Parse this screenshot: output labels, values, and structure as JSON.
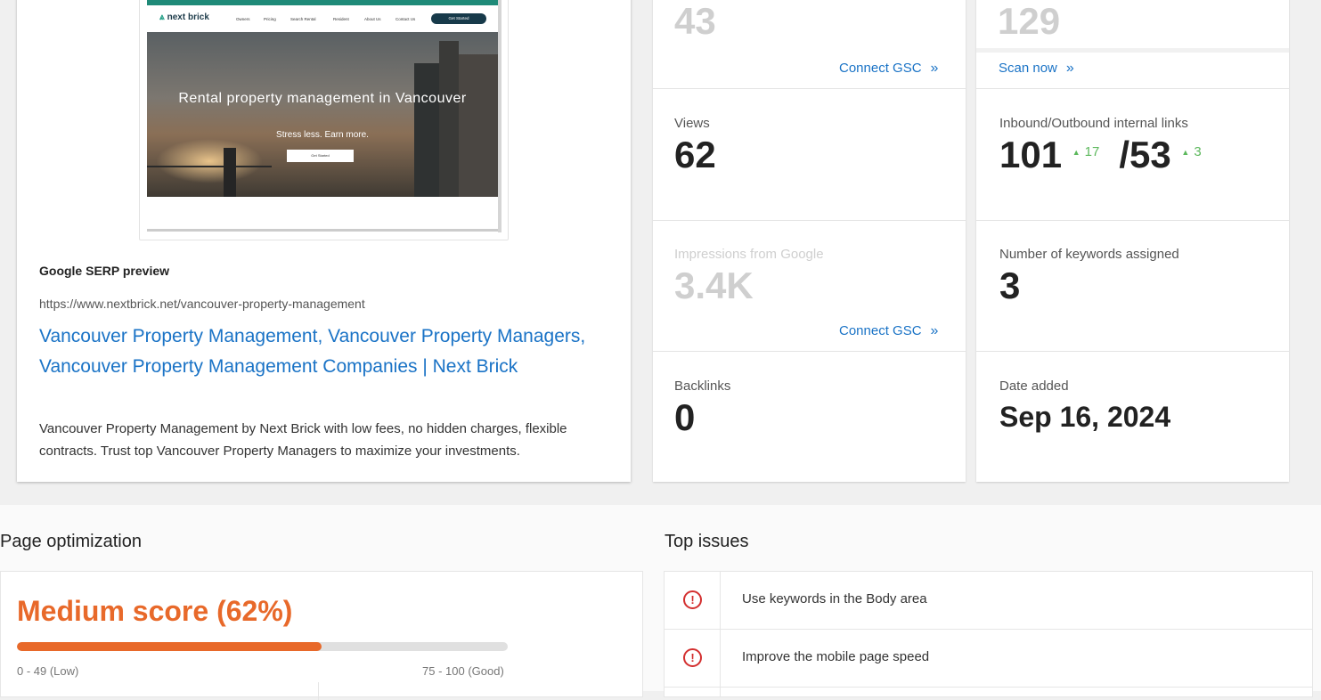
{
  "preview": {
    "site_logo": "next brick",
    "site_nav": [
      "Owners",
      "Pricing",
      "Search Rental",
      "Resident",
      "About Us",
      "Contact Us"
    ],
    "site_cta": "Get Started",
    "hero_title": "Rental property management in Vancouver",
    "hero_subtitle": "Stress less. Earn more.",
    "hero_button": "Get Started",
    "serp_heading": "Google SERP preview",
    "serp_url": "https://www.nextbrick.net/vancouver-property-management",
    "serp_title": "Vancouver Property Management, Vancouver Property Managers, Vancouver Property Management Companies | Next Brick",
    "serp_description": "Vancouver Property Management by Next Brick with low fees, no hidden charges, flexible contracts. Trust top Vancouver Property Managers to maximize your investments."
  },
  "metrics": {
    "top_left_value": "43",
    "top_left_link": "Connect GSC",
    "top_right_value": "129",
    "top_right_link": "Scan now",
    "views_label": "Views",
    "views_value": "62",
    "links_label": "Inbound/Outbound internal links",
    "inbound_value": "101",
    "inbound_delta": "17",
    "outbound_value": "/53",
    "outbound_delta": "3",
    "impressions_label": "Impressions from Google",
    "impressions_value": "3.4K",
    "impressions_link": "Connect GSC",
    "keywords_label": "Number of keywords assigned",
    "keywords_value": "3",
    "backlinks_label": "Backlinks",
    "backlinks_value": "0",
    "date_label": "Date added",
    "date_value": "Sep 16, 2024",
    "chevron": "»",
    "up_arrow": "▲"
  },
  "optimization": {
    "title": "Page optimization",
    "score_text": "Medium score (62%)",
    "score_percent": 62,
    "range_low": "0 - 49 (Low)",
    "range_good": "75 - 100 (Good)",
    "score_color": "#e8692a"
  },
  "issues": {
    "title": "Top issues",
    "icon": "!",
    "items": [
      "Use keywords in the Body area",
      "Improve the mobile page speed"
    ]
  }
}
